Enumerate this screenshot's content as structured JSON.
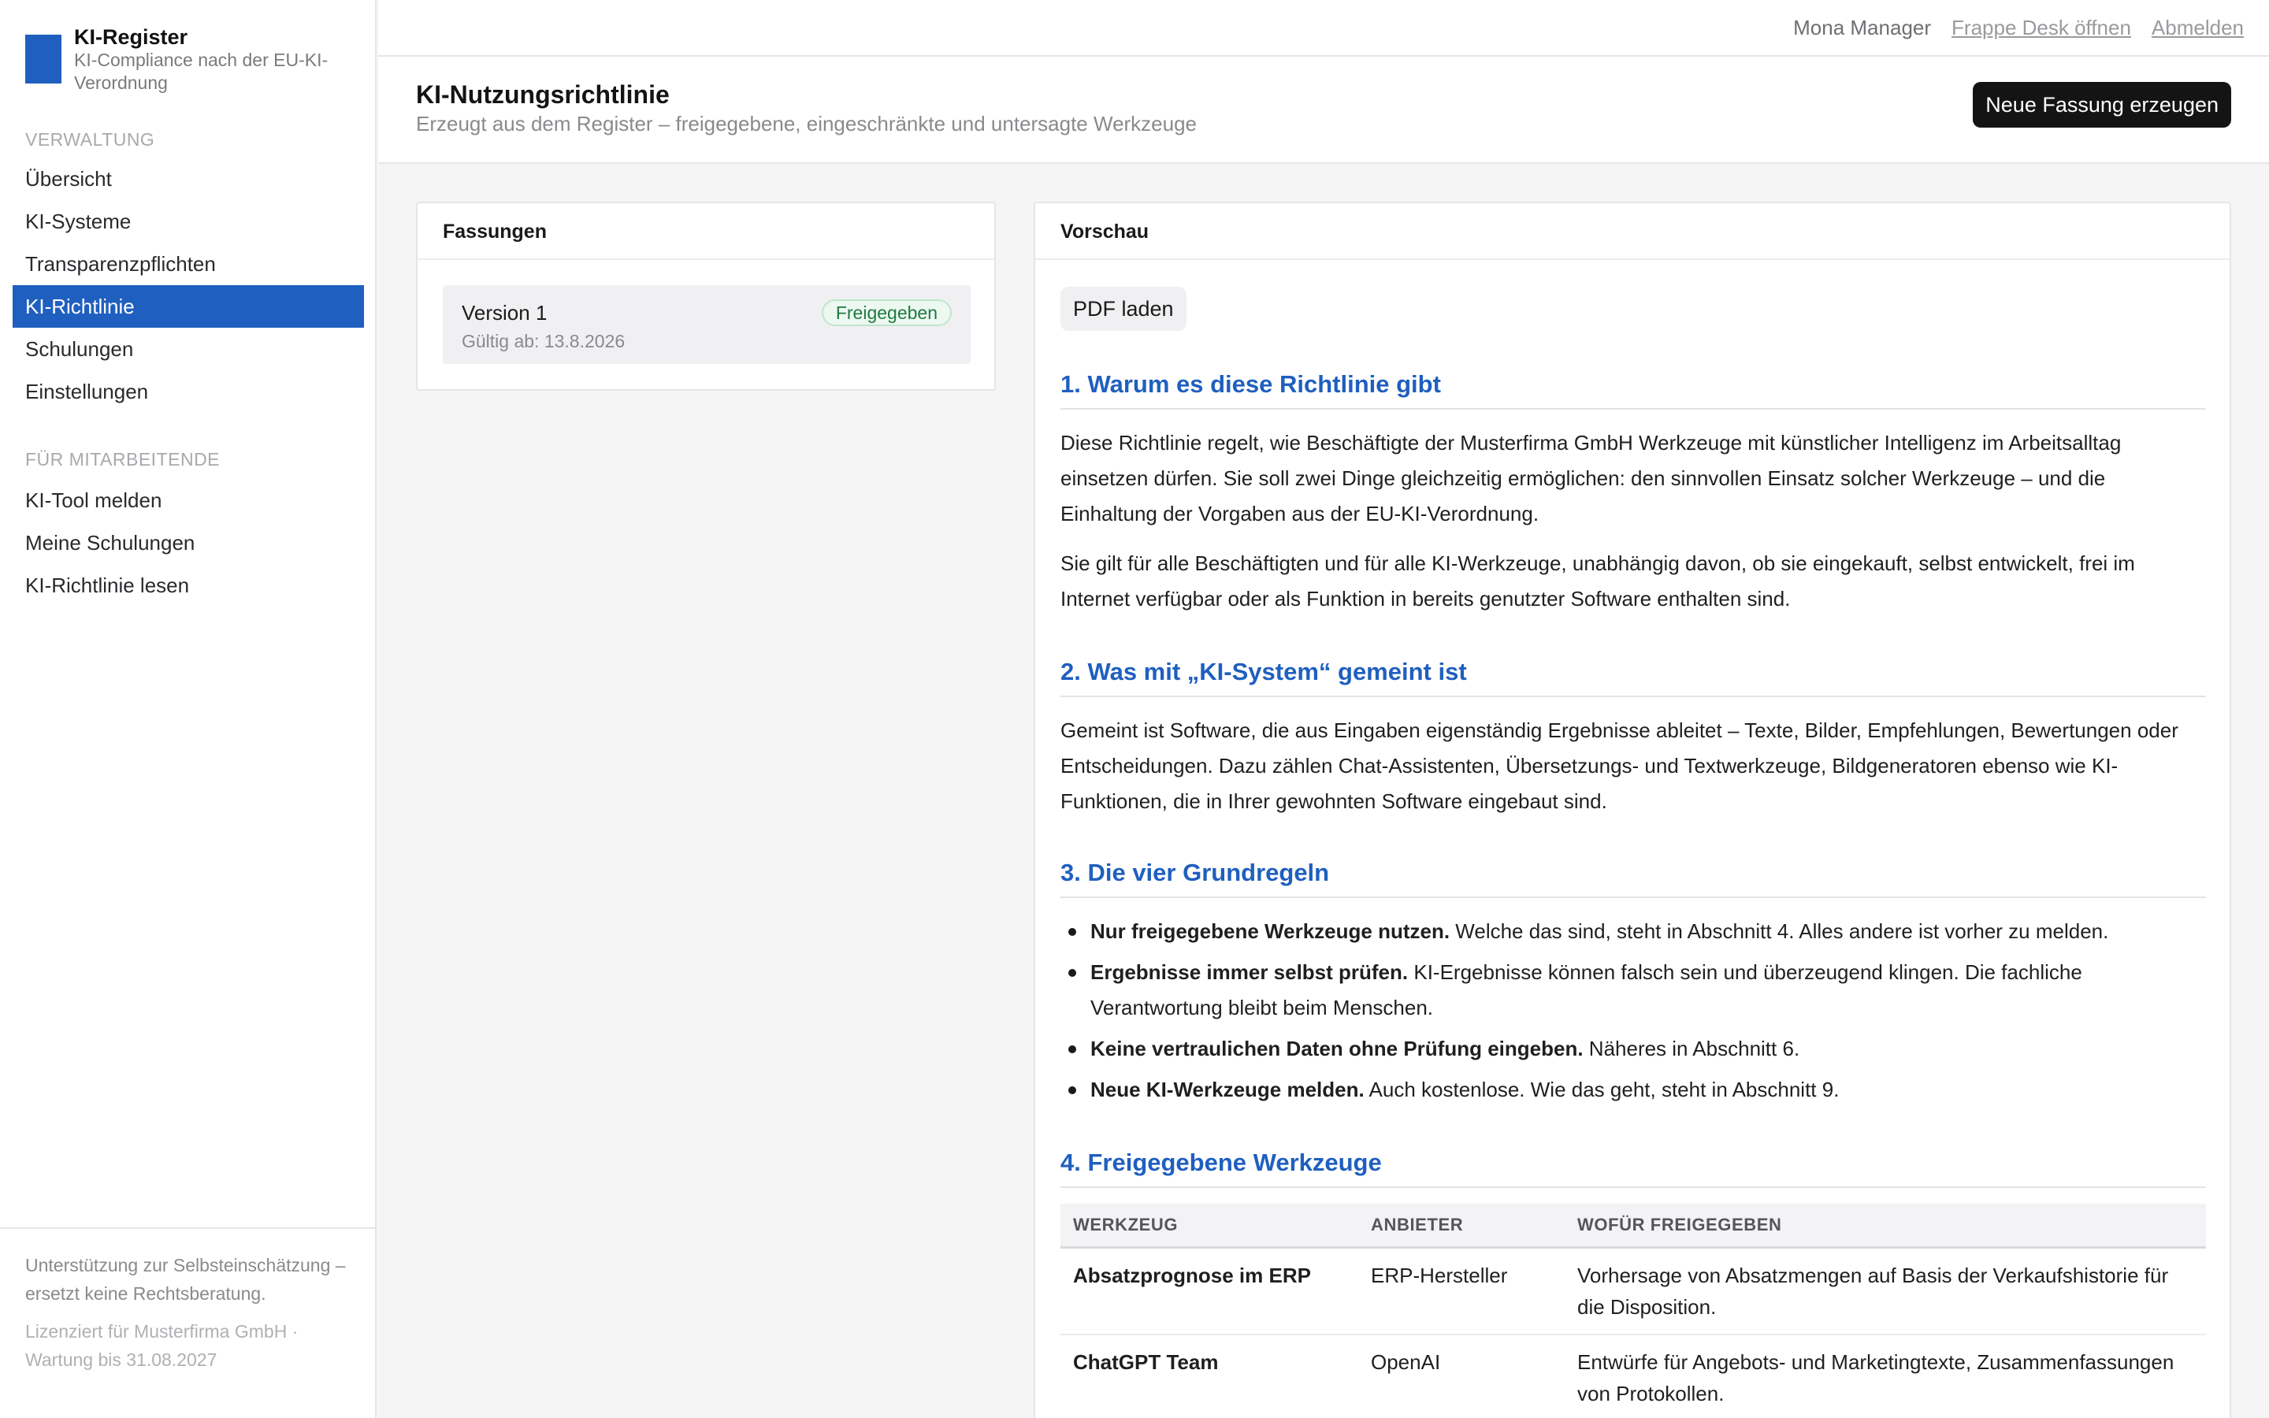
{
  "brand": {
    "title": "KI-Register",
    "subtitle": "KI-Compliance nach der EU-KI-Verordnung"
  },
  "sidebar": {
    "sections": [
      {
        "title": "Verwaltung",
        "items": [
          {
            "label": "Übersicht",
            "active": false
          },
          {
            "label": "KI-Systeme",
            "active": false
          },
          {
            "label": "Transparenzpflichten",
            "active": false
          },
          {
            "label": "KI-Richtlinie",
            "active": true
          },
          {
            "label": "Schulungen",
            "active": false
          },
          {
            "label": "Einstellungen",
            "active": false
          }
        ]
      },
      {
        "title": "Für Mitarbeitende",
        "items": [
          {
            "label": "KI-Tool melden",
            "active": false
          },
          {
            "label": "Meine Schulungen",
            "active": false
          },
          {
            "label": "KI-Richtlinie lesen",
            "active": false
          }
        ]
      }
    ],
    "footer_note": "Unterstützung zur Selbsteinschätzung – ersetzt keine Rechtsberatung.",
    "footer_license": "Lizenziert für Musterfirma GmbH · Wartung bis 31.08.2027"
  },
  "topbar": {
    "user": "Mona Manager",
    "desk_link": "Frappe Desk öffnen",
    "logout_link": "Abmelden"
  },
  "header": {
    "title": "KI-Nutzungsrichtlinie",
    "subtitle": "Erzeugt aus dem Register – freigegebene, eingeschränkte und untersagte Werkzeuge",
    "new_version_button": "Neue Fassung erzeugen"
  },
  "versions": {
    "title": "Fassungen",
    "items": [
      {
        "name": "Version 1",
        "valid_from": "Gültig ab: 13.8.2026",
        "status": "Freigegeben"
      }
    ]
  },
  "preview": {
    "title": "Vorschau",
    "pdf_button": "PDF laden",
    "s1": {
      "heading": "1. Warum es diese Richtlinie gibt",
      "p1": "Diese Richtlinie regelt, wie Beschäftigte der Musterfirma GmbH Werkzeuge mit künstlicher Intelligenz im Arbeitsalltag einsetzen dürfen. Sie soll zwei Dinge gleichzeitig ermöglichen: den sinnvollen Einsatz solcher Werkzeuge – und die Einhaltung der Vorgaben aus der EU-KI-Verordnung.",
      "p2": "Sie gilt für alle Beschäftigten und für alle KI-Werkzeuge, unabhängig davon, ob sie eingekauft, selbst entwickelt, frei im Internet verfügbar oder als Funktion in bereits genutzter Software enthalten sind."
    },
    "s2": {
      "heading": "2. Was mit „KI-System“ gemeint ist",
      "p1": "Gemeint ist Software, die aus Eingaben eigenständig Ergebnisse ableitet – Texte, Bilder, Empfehlungen, Bewertungen oder Entscheidungen. Dazu zählen Chat-Assistenten, Übersetzungs- und Textwerkzeuge, Bildgeneratoren ebenso wie KI-Funktionen, die in Ihrer gewohnten Software eingebaut sind."
    },
    "s3": {
      "heading": "3. Die vier Grundregeln",
      "rules": [
        {
          "bold": "Nur freigegebene Werkzeuge nutzen.",
          "text": " Welche das sind, steht in Abschnitt 4. Alles andere ist vorher zu melden."
        },
        {
          "bold": "Ergebnisse immer selbst prüfen.",
          "text": " KI-Ergebnisse können falsch sein und überzeugend klingen. Die fachliche Verantwortung bleibt beim Menschen."
        },
        {
          "bold": "Keine vertraulichen Daten ohne Prüfung eingeben.",
          "text": " Näheres in Abschnitt 6."
        },
        {
          "bold": "Neue KI-Werkzeuge melden.",
          "text": " Auch kostenlose. Wie das geht, steht in Abschnitt 9."
        }
      ]
    },
    "s4": {
      "heading": "4. Freigegebene Werkzeuge",
      "columns": [
        "Werkzeug",
        "Anbieter",
        "Wofür freigegeben"
      ],
      "rows": [
        {
          "tool": "Absatzprognose im ERP",
          "vendor": "ERP-Hersteller",
          "purpose": "Vorhersage von Absatzmengen auf Basis der Verkaufshistorie für die Disposition."
        },
        {
          "tool": "ChatGPT Team",
          "vendor": "OpenAI",
          "purpose": "Entwürfe für Angebots- und Marketingtexte, Zusammenfassungen von Protokollen."
        }
      ]
    }
  }
}
